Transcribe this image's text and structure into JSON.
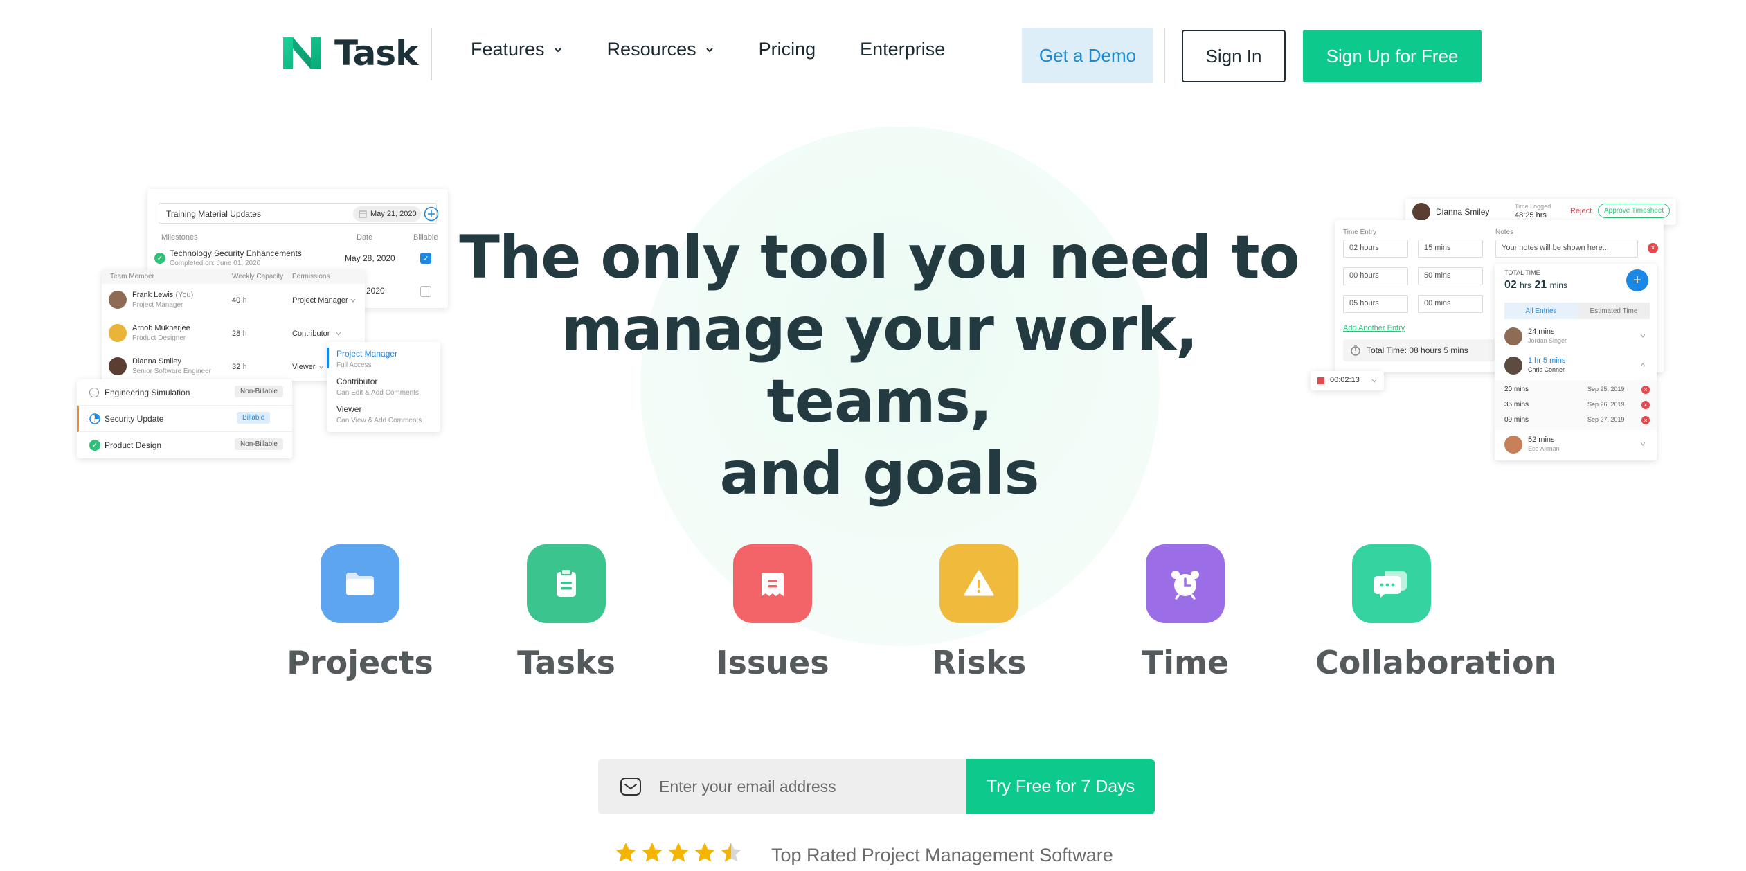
{
  "header": {
    "logo_text": "Task",
    "nav": [
      {
        "label": "Features",
        "has_dropdown": true
      },
      {
        "label": "Resources",
        "has_dropdown": true
      },
      {
        "label": "Pricing",
        "has_dropdown": false
      },
      {
        "label": "Enterprise",
        "has_dropdown": false
      }
    ],
    "demo_label": "Get a Demo",
    "signin_label": "Sign In",
    "signup_label": "Sign Up for Free"
  },
  "hero": {
    "title_line1": "The only tool you need to",
    "title_line2": "manage your work, teams,",
    "title_line3": "and goals"
  },
  "left_card": {
    "task_input": "Training Material Updates",
    "task_date": "May 21, 2020",
    "col_milestones": "Milestones",
    "col_date": "Date",
    "col_billable": "Billable",
    "milestone_1": "Technology Security Enhancements",
    "milestone_1_sub": "Completed on: June 01, 2020",
    "milestone_1_date": "May 28, 2020",
    "milestone_2_date": "2020"
  },
  "team_card": {
    "col_member": "Team Member",
    "col_capacity": "Weekly Capacity",
    "col_permissions": "Permissions",
    "members": [
      {
        "name": "Frank Lewis",
        "you": "(You)",
        "role": "Project Manager",
        "hours": "40",
        "unit": "h",
        "permission": "Project Manager"
      },
      {
        "name": "Arnob Mukherjee",
        "you": "",
        "role": "Product Designer",
        "hours": "28",
        "unit": "h",
        "permission": "Contributor"
      },
      {
        "name": "Dianna Smiley",
        "you": "",
        "role": "Senior Software Engineer",
        "hours": "32",
        "unit": "h",
        "permission": "Viewer"
      }
    ]
  },
  "perm_dropdown": {
    "options": [
      {
        "title": "Project Manager",
        "desc": "Full Access"
      },
      {
        "title": "Contributor",
        "desc": "Can Edit & Add Comments"
      },
      {
        "title": "Viewer",
        "desc": "Can View & Add Comments"
      }
    ]
  },
  "billing_card": {
    "items": [
      {
        "name": "Engineering Simulation",
        "tag": "Non-Billable"
      },
      {
        "name": "Security Update",
        "tag": "Billable"
      },
      {
        "name": "Product Design",
        "tag": "Non-Billable"
      }
    ]
  },
  "timesheet": {
    "user": "Dianna Smiley",
    "time_logged_label": "Time Logged",
    "time_logged_value": "48:25 hrs",
    "reject_label": "Reject",
    "approve_label": "Approve Timesheet",
    "time_entry_label": "Time Entry",
    "notes_label": "Notes",
    "entries": [
      {
        "hours": "02 hours",
        "mins": "15 mins"
      },
      {
        "hours": "00 hours",
        "mins": "50 mins"
      },
      {
        "hours": "05 hours",
        "mins": "00 mins"
      }
    ],
    "notes_placeholder": "Your notes will be shown here...",
    "add_entry": "Add Another Entry",
    "total_time_text": "Total Time: 08 hours 5 mins",
    "timer": "00:02:13"
  },
  "total_card": {
    "label": "TOTAL TIME",
    "value_hrs": "02",
    "hrs_label": "hrs",
    "value_mins": "21",
    "mins_label": "mins",
    "tab_all": "All Entries",
    "tab_estimated": "Estimated Time",
    "people": [
      {
        "time": "24 mins",
        "name": "Jordan Singer"
      },
      {
        "time": "1 hr 5 mins",
        "name": "Chris Conner"
      }
    ],
    "sub_entries": [
      {
        "time": "20 mins",
        "date": "Sep 25, 2019"
      },
      {
        "time": "36 mins",
        "date": "Sep 26, 2019"
      },
      {
        "time": "09 mins",
        "date": "Sep 27, 2019"
      }
    ],
    "last_person": {
      "time": "52 mins",
      "name": "Ece Akman"
    }
  },
  "features": [
    {
      "label": "Projects",
      "icon": "folder-icon",
      "color": "#5ea5f0"
    },
    {
      "label": "Tasks",
      "icon": "clipboard-icon",
      "color": "#3cc48e"
    },
    {
      "label": "Issues",
      "icon": "ticket-icon",
      "color": "#f26468"
    },
    {
      "label": "Risks",
      "icon": "warning-icon",
      "color": "#f0bb3d"
    },
    {
      "label": "Time",
      "icon": "alarm-clock-icon",
      "color": "#9b6ee8"
    },
    {
      "label": "Collaboration",
      "icon": "chat-icon",
      "color": "#34d3a0"
    }
  ],
  "cta": {
    "email_placeholder": "Enter your email address",
    "button_label": "Try Free for 7 Days"
  },
  "rating": {
    "stars": 4.5,
    "text": "Top Rated Project Management Software"
  },
  "colors": {
    "brand_green": "#0dc98b",
    "demo_bg": "#ddeef9",
    "demo_text": "#1d8ad2",
    "title": "#233b40",
    "star": "#f5b400"
  }
}
